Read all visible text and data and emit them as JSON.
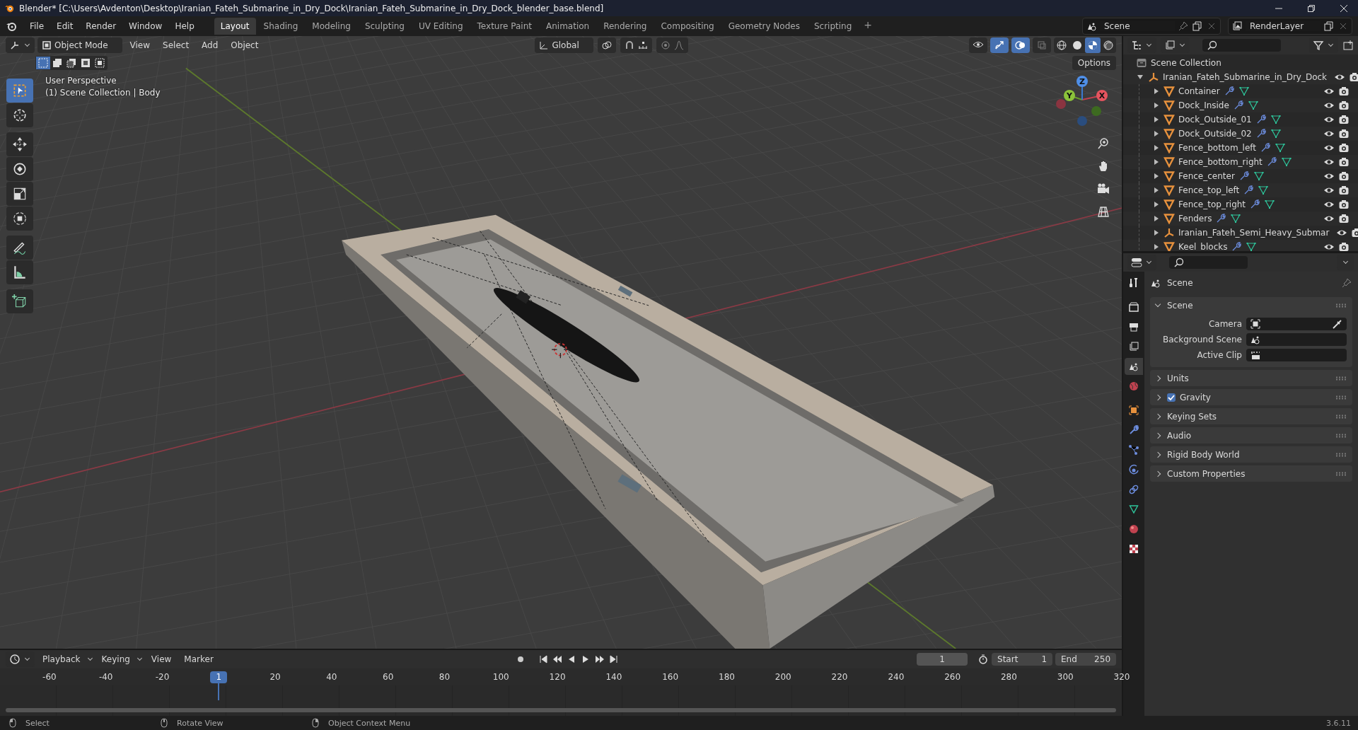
{
  "window": {
    "title": "Blender* [C:\\Users\\Avdenton\\Desktop\\Iranian_Fateh_Submarine_in_Dry_Dock\\Iranian_Fateh_Submarine_in_Dry_Dock_blender_base.blend]"
  },
  "menu": [
    "File",
    "Edit",
    "Render",
    "Window",
    "Help"
  ],
  "workspaces": [
    {
      "label": "Layout",
      "selected": true
    },
    {
      "label": "Shading",
      "selected": false
    },
    {
      "label": "Modeling",
      "selected": false
    },
    {
      "label": "Sculpting",
      "selected": false
    },
    {
      "label": "UV Editing",
      "selected": false
    },
    {
      "label": "Texture Paint",
      "selected": false
    },
    {
      "label": "Animation",
      "selected": false
    },
    {
      "label": "Rendering",
      "selected": false
    },
    {
      "label": "Compositing",
      "selected": false
    },
    {
      "label": "Geometry Nodes",
      "selected": false
    },
    {
      "label": "Scripting",
      "selected": false
    }
  ],
  "add_workspace": "+",
  "scene_selector": {
    "value": "Scene"
  },
  "view_layer_selector": {
    "value": "RenderLayer"
  },
  "viewport": {
    "mode": "Object Mode",
    "menus": [
      "View",
      "Select",
      "Add",
      "Object"
    ],
    "orientation": "Global",
    "options": "Options",
    "overlay_lines": [
      "User Perspective",
      "(1) Scene Collection | Body"
    ],
    "tools": [
      {
        "kind": "select",
        "selected": true
      },
      {
        "kind": "cursor",
        "selected": false
      },
      {
        "kind": "move",
        "selected": false
      },
      {
        "kind": "rotate",
        "selected": false
      },
      {
        "kind": "scale",
        "selected": false
      },
      {
        "kind": "transform",
        "selected": false
      },
      {
        "kind": "annotate",
        "selected": false
      },
      {
        "kind": "measure",
        "selected": false
      },
      {
        "kind": "add-cube",
        "selected": false
      }
    ],
    "shading": [
      {
        "kind": "wireframe",
        "selected": false
      },
      {
        "kind": "solid",
        "selected": false
      },
      {
        "kind": "material",
        "selected": true
      },
      {
        "kind": "rendered",
        "selected": false
      }
    ],
    "gizmo_axes": [
      "X",
      "Y",
      "Z"
    ]
  },
  "outliner": {
    "root": {
      "name": "Scene Collection",
      "children": [
        {
          "name": "Iranian_Fateh_Submarine_in_Dry_Dock",
          "kind": "empty",
          "expanded": true,
          "children": [
            {
              "name": "Container",
              "kind": "mesh",
              "expanded": false
            },
            {
              "name": "Dock_Inside",
              "kind": "mesh",
              "expanded": false
            },
            {
              "name": "Dock_Outside_01",
              "kind": "mesh",
              "expanded": false
            },
            {
              "name": "Dock_Outside_02",
              "kind": "mesh",
              "expanded": false
            },
            {
              "name": "Fence_bottom_left",
              "kind": "mesh",
              "expanded": false
            },
            {
              "name": "Fence_bottom_right",
              "kind": "mesh",
              "expanded": false
            },
            {
              "name": "Fence_center",
              "kind": "mesh",
              "expanded": false
            },
            {
              "name": "Fence_top_left",
              "kind": "mesh",
              "expanded": false
            },
            {
              "name": "Fence_top_right",
              "kind": "mesh",
              "expanded": false
            },
            {
              "name": "Fenders",
              "kind": "mesh",
              "expanded": false
            },
            {
              "name": "Iranian_Fateh_Semi_Heavy_Submar",
              "kind": "empty",
              "expanded": false
            },
            {
              "name": "Keel_blocks",
              "kind": "mesh",
              "expanded": false
            }
          ]
        }
      ]
    }
  },
  "properties": {
    "tabs": [
      {
        "kind": "tool",
        "selected": false
      },
      {
        "kind": "render",
        "selected": false
      },
      {
        "kind": "output",
        "selected": false
      },
      {
        "kind": "view-layer",
        "selected": false
      },
      {
        "kind": "scene",
        "selected": true
      },
      {
        "kind": "world",
        "selected": false
      },
      {
        "kind": "object",
        "selected": false
      },
      {
        "kind": "modifiers",
        "selected": false
      },
      {
        "kind": "particles",
        "selected": false
      },
      {
        "kind": "physics",
        "selected": false
      },
      {
        "kind": "constraints",
        "selected": false
      },
      {
        "kind": "data",
        "selected": false
      },
      {
        "kind": "material",
        "selected": false
      },
      {
        "kind": "texture",
        "selected": false
      }
    ],
    "context": "Scene",
    "panels": [
      {
        "title": "Scene",
        "expanded": true,
        "fields": [
          {
            "label": "Camera",
            "kind": "camera"
          },
          {
            "label": "Background Scene",
            "kind": "scene"
          },
          {
            "label": "Active Clip",
            "kind": "clip"
          }
        ]
      },
      {
        "title": "Units",
        "expanded": false
      },
      {
        "title": "Gravity",
        "expanded": false,
        "checked": true
      },
      {
        "title": "Keying Sets",
        "expanded": false
      },
      {
        "title": "Audio",
        "expanded": false
      },
      {
        "title": "Rigid Body World",
        "expanded": false
      },
      {
        "title": "Custom Properties",
        "expanded": false
      }
    ]
  },
  "timeline": {
    "menus": [
      "Playback",
      "Keying",
      "View",
      "Marker"
    ],
    "current_frame": "1",
    "start_label": "Start",
    "start": "1",
    "end_label": "End",
    "end": "250",
    "ruler": [
      "-60",
      "-40",
      "-20",
      "20",
      "40",
      "60",
      "80",
      "100",
      "120",
      "140",
      "160",
      "180",
      "200",
      "220",
      "240",
      "260",
      "280",
      "300",
      "320"
    ],
    "playhead": "1"
  },
  "status_bar": {
    "hints": [
      "Select",
      "Rotate View",
      "Object Context Menu"
    ],
    "version": "3.6.11"
  }
}
